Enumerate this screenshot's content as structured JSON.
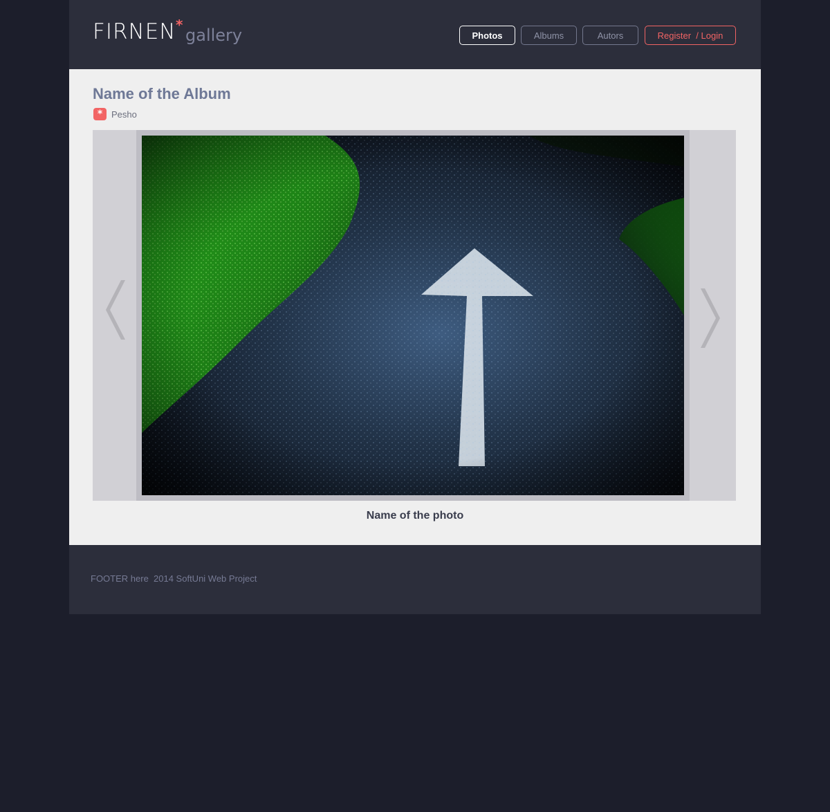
{
  "header": {
    "logo_main": "FIRNEN",
    "logo_star": "*",
    "logo_sub": "gallery",
    "nav": {
      "photos": "Photos",
      "albums": "Albums",
      "autors": "Autors",
      "auth": "Register  / Login"
    }
  },
  "album": {
    "title": "Name of the Album",
    "author_icon": "asterisk-icon",
    "author_glyph": "*",
    "author": "Pesho"
  },
  "viewer": {
    "prev_icon": "chevron-left-icon",
    "next_icon": "chevron-right-icon",
    "photo_caption": "Name of the photo"
  },
  "footer": {
    "text": "FOOTER here  2014 SoftUni Web Project"
  },
  "colors": {
    "page_bg": "#1c1e2b",
    "header_bg": "#2c2e3b",
    "content_bg": "#efefef",
    "accent": "#f26464",
    "title": "#6e7896"
  }
}
